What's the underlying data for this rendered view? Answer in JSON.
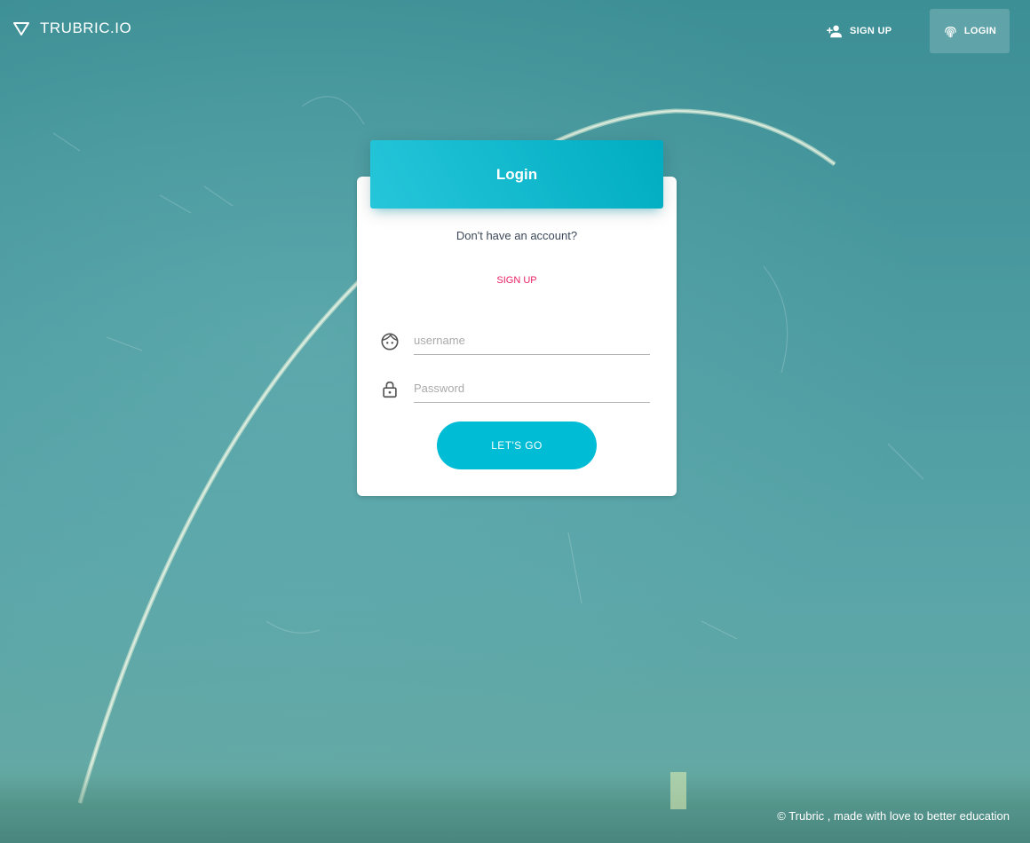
{
  "navbar": {
    "brand": "TRUBRIC.IO",
    "brand_icon": "triangle-down-icon",
    "signup_label": "SIGN UP",
    "signup_icon": "person-add-icon",
    "login_label": "LOGIN",
    "login_icon": "fingerprint-icon"
  },
  "card": {
    "title": "Login",
    "subtitle": "Don't have an account?",
    "signup_link": "SIGN UP",
    "username": {
      "placeholder": "username",
      "value": "",
      "icon": "face-icon"
    },
    "password": {
      "placeholder": "Password",
      "value": "",
      "icon": "lock-icon"
    },
    "submit_label": "LET'S GO"
  },
  "footer": {
    "text": "© Trubric , made with love to better education"
  },
  "colors": {
    "accent": "#00bcd4",
    "link": "#e91e63",
    "header_gradient_start": "#26c6da",
    "header_gradient_end": "#00acc1"
  }
}
